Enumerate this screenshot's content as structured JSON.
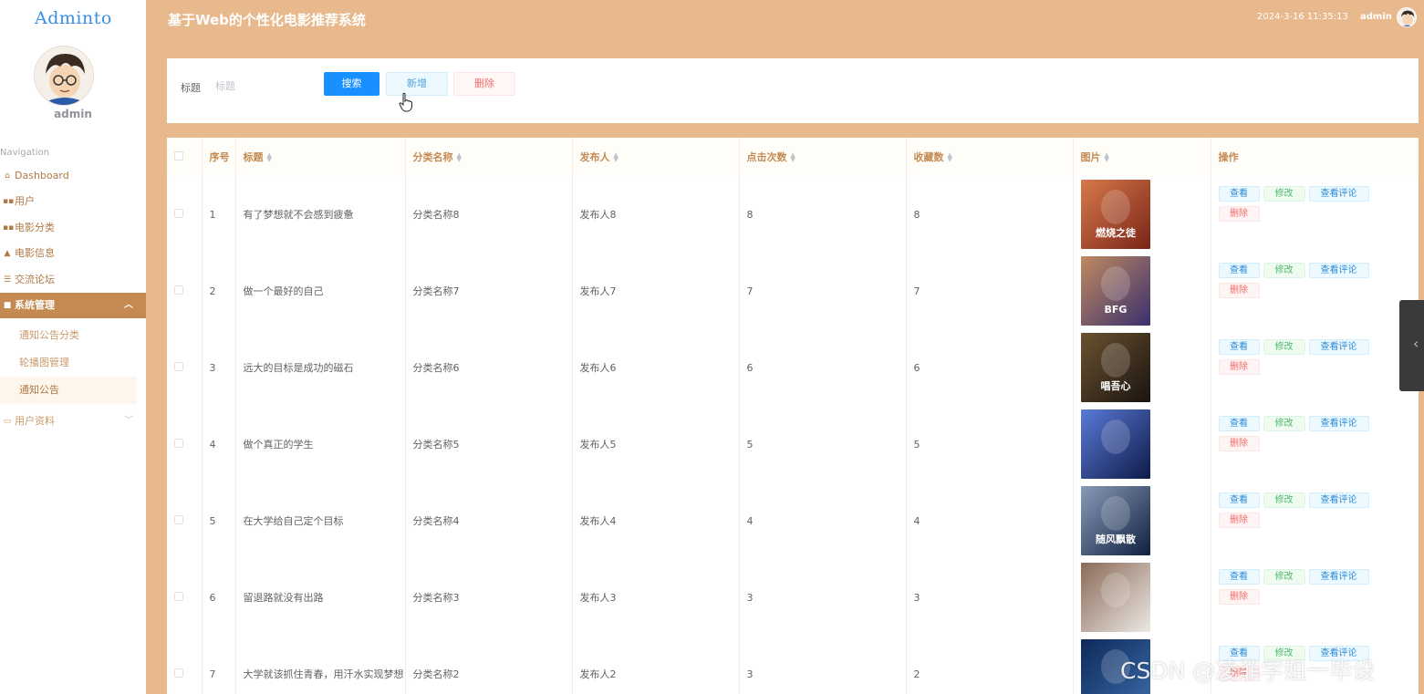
{
  "brand": "Adminto",
  "sidebar": {
    "user": "admin",
    "nav_caption": "Navigation",
    "items": [
      {
        "label": "Dashboard",
        "icon": "home-icon"
      },
      {
        "label": "用户",
        "icon": "grid-icon"
      },
      {
        "label": "电影分类",
        "icon": "grid-icon"
      },
      {
        "label": "电影信息",
        "icon": "person-icon"
      },
      {
        "label": "交流论坛",
        "icon": "list-icon"
      },
      {
        "label": "系统管理",
        "icon": "book-icon",
        "expanded": true
      },
      {
        "label": "用户资料",
        "icon": "card-icon"
      }
    ],
    "sub_items": [
      {
        "label": "通知公告分类"
      },
      {
        "label": "轮播图管理"
      },
      {
        "label": "通知公告",
        "selected": true
      }
    ]
  },
  "header": {
    "title": "基于Web的个性化电影推荐系统",
    "datetime": "2024-3-16 11:35:13",
    "user": "admin"
  },
  "search": {
    "label": "标题",
    "placeholder": "标题",
    "search_btn": "搜索",
    "add_btn": "新增",
    "delete_btn": "删除"
  },
  "table": {
    "columns": [
      "序号",
      "标题",
      "分类名称",
      "发布人",
      "点击次数",
      "收藏数",
      "图片",
      "操作"
    ],
    "rows": [
      {
        "no": "1",
        "title": "有了梦想就不会感到疲惫",
        "category": "分类名称8",
        "publisher": "发布人8",
        "clicks": "8",
        "favorites": "8",
        "poster_caption": "燃烧之徒"
      },
      {
        "no": "2",
        "title": "做一个最好的自己",
        "category": "分类名称7",
        "publisher": "发布人7",
        "clicks": "7",
        "favorites": "7",
        "poster_caption": "BFG"
      },
      {
        "no": "3",
        "title": "远大的目标是成功的磁石",
        "category": "分类名称6",
        "publisher": "发布人6",
        "clicks": "6",
        "favorites": "6",
        "poster_caption": "唱吾心"
      },
      {
        "no": "4",
        "title": "做个真正的学生",
        "category": "分类名称5",
        "publisher": "发布人5",
        "clicks": "5",
        "favorites": "5",
        "poster_caption": ""
      },
      {
        "no": "5",
        "title": "在大学给自己定个目标",
        "category": "分类名称4",
        "publisher": "发布人4",
        "clicks": "4",
        "favorites": "4",
        "poster_caption": "随风飘散"
      },
      {
        "no": "6",
        "title": "留退路就没有出路",
        "category": "分类名称3",
        "publisher": "发布人3",
        "clicks": "3",
        "favorites": "3",
        "poster_caption": ""
      },
      {
        "no": "7",
        "title": "大学就该抓住青春，用汗水实现梦想",
        "category": "分类名称2",
        "publisher": "发布人2",
        "clicks": "3",
        "favorites": "2",
        "poster_caption": ""
      }
    ],
    "actions": {
      "view": "查看",
      "edit": "修改",
      "comments": "查看评论",
      "delete": "删除"
    }
  },
  "watermark": "CSDN @凌菲学姐一毕设",
  "colors": {
    "header_bg": "#e7b98c",
    "accent": "#c48a52",
    "primary": "#1890ff"
  }
}
